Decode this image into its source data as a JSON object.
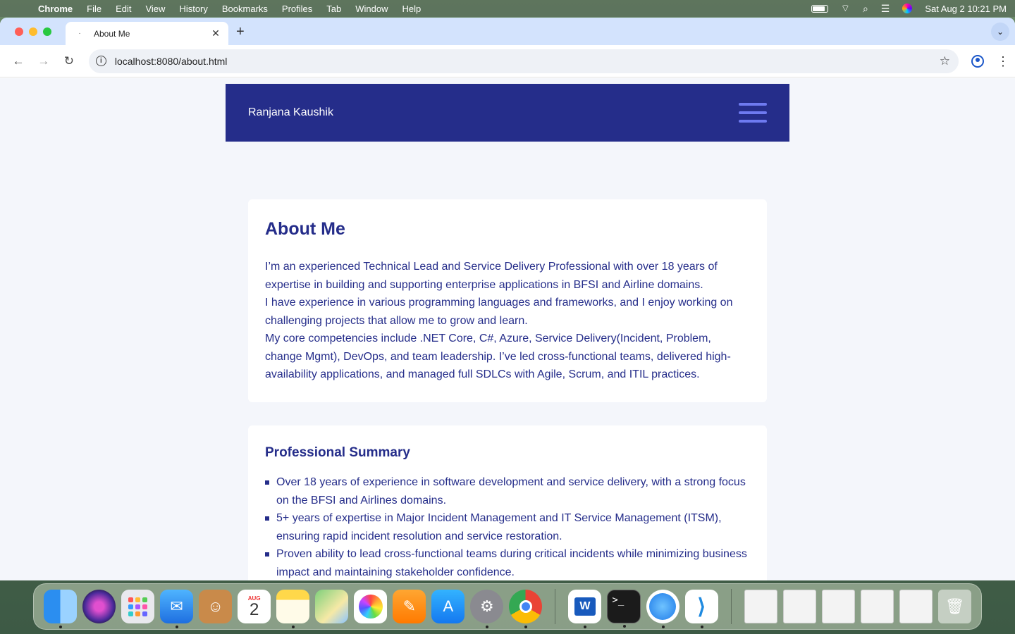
{
  "menubar": {
    "app_name": "Chrome",
    "items": [
      "File",
      "Edit",
      "View",
      "History",
      "Bookmarks",
      "Profiles",
      "Tab",
      "Window",
      "Help"
    ],
    "clock": "Sat Aug 2  10:21 PM"
  },
  "browser": {
    "tab_title": "About Me",
    "tab_favicon": "·",
    "url": "localhost:8080/about.html"
  },
  "site": {
    "brand": "Ranjana Kaushik"
  },
  "about": {
    "heading": "About Me",
    "paragraphs": [
      "I’m an experienced Technical Lead and Service Delivery Professional with over 18 years of expertise in building and supporting enterprise applications in BFSI and Airline domains.",
      "I have experience in various programming languages and frameworks, and I enjoy working on challenging projects that allow me to grow and learn.",
      "My core competencies include .NET Core, C#, Azure, Service Delivery(Incident, Problem, change Mgmt), DevOps, and team leadership. I’ve led cross-functional teams, delivered high-availability applications, and managed full SDLCs with Agile, Scrum, and ITIL practices."
    ]
  },
  "summary": {
    "heading": "Professional Summary",
    "items": [
      "Over 18 years of experience in software development and service delivery, with a strong focus on the BFSI and Airlines domains.",
      "5+ years of expertise in Major Incident Management and IT Service Management (ITSM), ensuring rapid incident resolution and service restoration.",
      "Proven ability to lead cross-functional teams during critical incidents while minimizing business impact and maintaining stakeholder confidence."
    ]
  },
  "dock": {
    "calendar_month": "AUG",
    "calendar_day": "2",
    "terminal_prompt": ">_",
    "word_letter": "W"
  }
}
